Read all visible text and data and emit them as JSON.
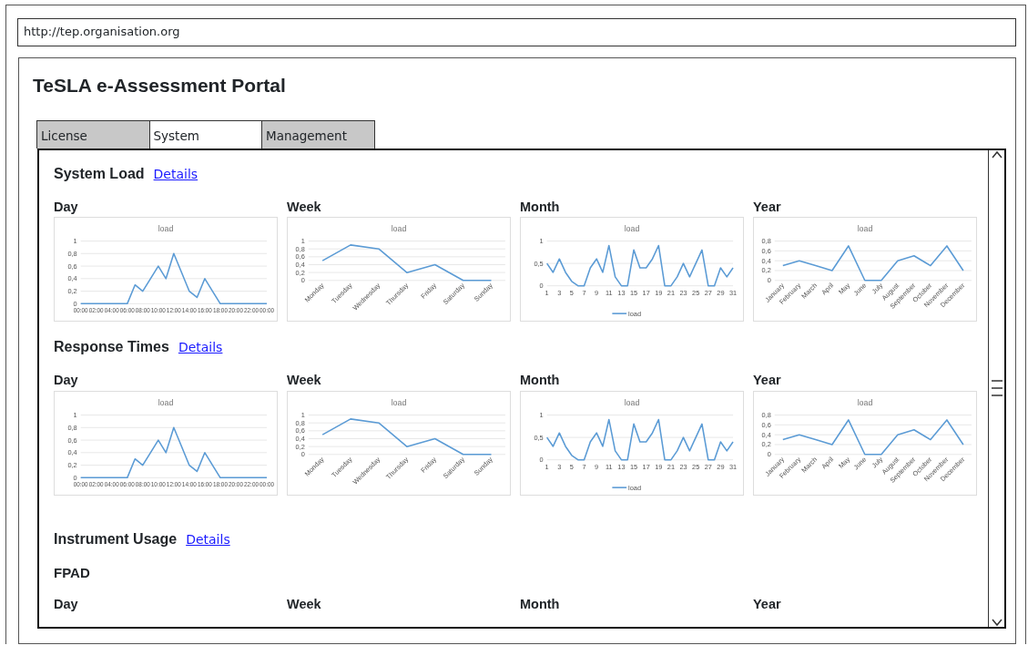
{
  "address_bar": {
    "value": "http://tep.organisation.org"
  },
  "title": "TeSLA e-Assessment Portal",
  "tabs": [
    {
      "label": "License",
      "selected": false
    },
    {
      "label": "System",
      "selected": true
    },
    {
      "label": "Management",
      "selected": false
    }
  ],
  "sections": [
    {
      "title": "System Load",
      "link": "Details",
      "charts": [
        {
          "period": "Day",
          "chart_data": {
            "type": "line",
            "title": "load",
            "x": [
              0,
              1,
              2,
              3,
              4,
              5,
              6,
              7,
              8,
              9,
              10,
              11,
              12,
              13,
              14,
              15,
              16,
              17,
              18,
              19,
              20,
              21,
              22,
              23,
              24
            ],
            "series": [
              {
                "color": "#5b9bd5",
                "values": [
                  0,
                  0,
                  0,
                  0,
                  0,
                  0,
                  0,
                  0.3,
                  0.2,
                  0.4,
                  0.6,
                  0.4,
                  0.8,
                  0.5,
                  0.2,
                  0.1,
                  0.4,
                  0.2,
                  0,
                  0,
                  0,
                  0,
                  0,
                  0,
                  0
                ]
              }
            ],
            "grid": true,
            "xlim": [
              0,
              24
            ],
            "ylim": [
              0,
              1
            ],
            "yticks": [
              {
                "value": 0,
                "label": "0"
              },
              {
                "value": 0.2,
                "label": "0,2"
              },
              {
                "value": 0.4,
                "label": "0,4"
              },
              {
                "value": 0.6,
                "label": "0,6"
              },
              {
                "value": 0.8,
                "label": "0,8"
              },
              {
                "value": 1,
                "label": "1"
              }
            ],
            "xticks": [
              {
                "value": 0,
                "label": "00:00"
              },
              {
                "value": 2,
                "label": "02:00"
              },
              {
                "value": 4,
                "label": "04:00"
              },
              {
                "value": 6,
                "label": "06:00"
              },
              {
                "value": 8,
                "label": "08:00"
              },
              {
                "value": 10,
                "label": "10:00"
              },
              {
                "value": 12,
                "label": "12:00"
              },
              {
                "value": 14,
                "label": "14:00"
              },
              {
                "value": 16,
                "label": "16:00"
              },
              {
                "value": 18,
                "label": "18:00"
              },
              {
                "value": 20,
                "label": "20:00"
              },
              {
                "value": 22,
                "label": "22:00"
              },
              {
                "value": 24,
                "label": "00:00"
              }
            ]
          }
        },
        {
          "period": "Week",
          "chart_data": {
            "type": "line",
            "title": "load",
            "categories": [
              "Monday",
              "Tuesday",
              "Wednesday",
              "Thursday",
              "Friday",
              "Saturday",
              "Sunday"
            ],
            "series": [
              {
                "color": "#5b9bd5",
                "values": [
                  0.5,
                  0.9,
                  0.8,
                  0.2,
                  0.4,
                  0,
                  0
                ]
              }
            ],
            "grid": true,
            "ylim": [
              0,
              1
            ],
            "yticks": [
              {
                "value": 0,
                "label": "0"
              },
              {
                "value": 0.2,
                "label": "0,2"
              },
              {
                "value": 0.4,
                "label": "0,4"
              },
              {
                "value": 0.6,
                "label": "0,6"
              },
              {
                "value": 0.8,
                "label": "0,8"
              },
              {
                "value": 1,
                "label": "1"
              }
            ]
          }
        },
        {
          "period": "Month",
          "chart_data": {
            "type": "line",
            "title": "load",
            "x": [
              1,
              2,
              3,
              4,
              5,
              6,
              7,
              8,
              9,
              10,
              11,
              12,
              13,
              14,
              15,
              16,
              17,
              18,
              19,
              20,
              21,
              22,
              23,
              24,
              25,
              26,
              27,
              28,
              29,
              30,
              31
            ],
            "series": [
              {
                "name": "load",
                "color": "#5b9bd5",
                "values": [
                  0.5,
                  0.3,
                  0.6,
                  0.3,
                  0.1,
                  0,
                  0,
                  0.4,
                  0.6,
                  0.3,
                  0.9,
                  0.2,
                  0,
                  0,
                  0.8,
                  0.4,
                  0.4,
                  0.6,
                  0.9,
                  0,
                  0,
                  0.2,
                  0.5,
                  0.2,
                  0.5,
                  0.8,
                  0,
                  0,
                  0.4,
                  0.2,
                  0.4
                ]
              }
            ],
            "grid": true,
            "xlim": [
              1,
              31
            ],
            "ylim": [
              0,
              1
            ],
            "yticks": [
              {
                "value": 0,
                "label": "0"
              },
              {
                "value": 0.5,
                "label": "0,5"
              },
              {
                "value": 1,
                "label": "1"
              }
            ],
            "xticks": [
              1,
              3,
              5,
              7,
              9,
              11,
              13,
              15,
              17,
              19,
              21,
              23,
              25,
              27,
              29,
              31
            ],
            "legend": true
          }
        },
        {
          "period": "Year",
          "chart_data": {
            "type": "line",
            "title": "load",
            "categories": [
              "January",
              "February",
              "March",
              "April",
              "May",
              "June",
              "July",
              "August",
              "September",
              "October",
              "November",
              "December"
            ],
            "series": [
              {
                "color": "#5b9bd5",
                "values": [
                  0.3,
                  0.4,
                  0.3,
                  0.2,
                  0.7,
                  0,
                  0,
                  0.4,
                  0.5,
                  0.3,
                  0.7,
                  0.2
                ]
              }
            ],
            "grid": true,
            "ylim": [
              0,
              0.8
            ],
            "yticks": [
              {
                "value": 0,
                "label": "0"
              },
              {
                "value": 0.2,
                "label": "0,2"
              },
              {
                "value": 0.4,
                "label": "0,4"
              },
              {
                "value": 0.6,
                "label": "0,6"
              },
              {
                "value": 0.8,
                "label": "0,8"
              }
            ]
          }
        }
      ]
    },
    {
      "title": "Response Times",
      "link": "Details",
      "charts": [
        {
          "period": "Day",
          "chart_data": {
            "type": "line",
            "title": "load",
            "x": [
              0,
              1,
              2,
              3,
              4,
              5,
              6,
              7,
              8,
              9,
              10,
              11,
              12,
              13,
              14,
              15,
              16,
              17,
              18,
              19,
              20,
              21,
              22,
              23,
              24
            ],
            "series": [
              {
                "color": "#5b9bd5",
                "values": [
                  0,
                  0,
                  0,
                  0,
                  0,
                  0,
                  0,
                  0.3,
                  0.2,
                  0.4,
                  0.6,
                  0.4,
                  0.8,
                  0.5,
                  0.2,
                  0.1,
                  0.4,
                  0.2,
                  0,
                  0,
                  0,
                  0,
                  0,
                  0,
                  0
                ]
              }
            ],
            "grid": true,
            "xlim": [
              0,
              24
            ],
            "ylim": [
              0,
              1
            ],
            "yticks": [
              {
                "value": 0,
                "label": "0"
              },
              {
                "value": 0.2,
                "label": "0,2"
              },
              {
                "value": 0.4,
                "label": "0,4"
              },
              {
                "value": 0.6,
                "label": "0,6"
              },
              {
                "value": 0.8,
                "label": "0,8"
              },
              {
                "value": 1,
                "label": "1"
              }
            ],
            "xticks": [
              {
                "value": 0,
                "label": "00:00"
              },
              {
                "value": 2,
                "label": "02:00"
              },
              {
                "value": 4,
                "label": "04:00"
              },
              {
                "value": 6,
                "label": "06:00"
              },
              {
                "value": 8,
                "label": "08:00"
              },
              {
                "value": 10,
                "label": "10:00"
              },
              {
                "value": 12,
                "label": "12:00"
              },
              {
                "value": 14,
                "label": "14:00"
              },
              {
                "value": 16,
                "label": "16:00"
              },
              {
                "value": 18,
                "label": "18:00"
              },
              {
                "value": 20,
                "label": "20:00"
              },
              {
                "value": 22,
                "label": "22:00"
              },
              {
                "value": 24,
                "label": "00:00"
              }
            ]
          }
        },
        {
          "period": "Week",
          "chart_data": {
            "type": "line",
            "title": "load",
            "categories": [
              "Monday",
              "Tuesday",
              "Wednesday",
              "Thursday",
              "Friday",
              "Saturday",
              "Sunday"
            ],
            "series": [
              {
                "color": "#5b9bd5",
                "values": [
                  0.5,
                  0.9,
                  0.8,
                  0.2,
                  0.4,
                  0,
                  0
                ]
              }
            ],
            "grid": true,
            "ylim": [
              0,
              1
            ],
            "yticks": [
              {
                "value": 0,
                "label": "0"
              },
              {
                "value": 0.2,
                "label": "0,2"
              },
              {
                "value": 0.4,
                "label": "0,4"
              },
              {
                "value": 0.6,
                "label": "0,6"
              },
              {
                "value": 0.8,
                "label": "0,8"
              },
              {
                "value": 1,
                "label": "1"
              }
            ]
          }
        },
        {
          "period": "Month",
          "chart_data": {
            "type": "line",
            "title": "load",
            "x": [
              1,
              2,
              3,
              4,
              5,
              6,
              7,
              8,
              9,
              10,
              11,
              12,
              13,
              14,
              15,
              16,
              17,
              18,
              19,
              20,
              21,
              22,
              23,
              24,
              25,
              26,
              27,
              28,
              29,
              30,
              31
            ],
            "series": [
              {
                "name": "load",
                "color": "#5b9bd5",
                "values": [
                  0.5,
                  0.3,
                  0.6,
                  0.3,
                  0.1,
                  0,
                  0,
                  0.4,
                  0.6,
                  0.3,
                  0.9,
                  0.2,
                  0,
                  0,
                  0.8,
                  0.4,
                  0.4,
                  0.6,
                  0.9,
                  0,
                  0,
                  0.2,
                  0.5,
                  0.2,
                  0.5,
                  0.8,
                  0,
                  0,
                  0.4,
                  0.2,
                  0.4
                ]
              }
            ],
            "grid": true,
            "xlim": [
              1,
              31
            ],
            "ylim": [
              0,
              1
            ],
            "yticks": [
              {
                "value": 0,
                "label": "0"
              },
              {
                "value": 0.5,
                "label": "0,5"
              },
              {
                "value": 1,
                "label": "1"
              }
            ],
            "xticks": [
              1,
              3,
              5,
              7,
              9,
              11,
              13,
              15,
              17,
              19,
              21,
              23,
              25,
              27,
              29,
              31
            ],
            "legend": true
          }
        },
        {
          "period": "Year",
          "chart_data": {
            "type": "line",
            "title": "load",
            "categories": [
              "January",
              "February",
              "March",
              "April",
              "May",
              "June",
              "July",
              "August",
              "September",
              "October",
              "November",
              "December"
            ],
            "series": [
              {
                "color": "#5b9bd5",
                "values": [
                  0.3,
                  0.4,
                  0.3,
                  0.2,
                  0.7,
                  0,
                  0,
                  0.4,
                  0.5,
                  0.3,
                  0.7,
                  0.2
                ]
              }
            ],
            "grid": true,
            "ylim": [
              0,
              0.8
            ],
            "yticks": [
              {
                "value": 0,
                "label": "0"
              },
              {
                "value": 0.2,
                "label": "0,2"
              },
              {
                "value": 0.4,
                "label": "0,4"
              },
              {
                "value": 0.6,
                "label": "0,6"
              },
              {
                "value": 0.8,
                "label": "0,8"
              }
            ]
          }
        }
      ]
    },
    {
      "title": "Instrument Usage",
      "link": "Details",
      "subsections": [
        {
          "title": "FPAD",
          "periods": [
            "Day",
            "Week",
            "Month",
            "Year"
          ]
        }
      ]
    }
  ]
}
